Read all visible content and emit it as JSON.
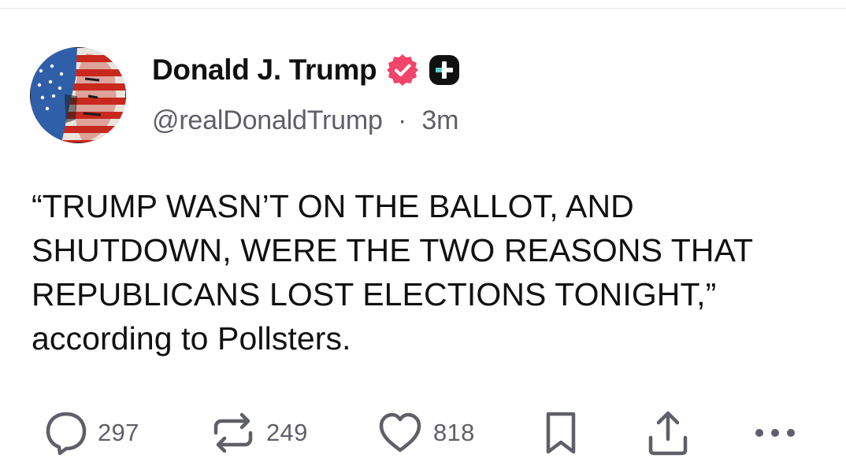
{
  "post": {
    "author": {
      "display_name": "Donald J. Trump",
      "handle": "@realDonaldTrump",
      "separator": "·",
      "time": "3m"
    },
    "text": "“TRUMP WASN’T ON THE BALLOT, AND SHUTDOWN, WERE THE TWO REASONS THAT REPUBLICANS LOST ELECTIONS TONIGHT,” according to Pollsters."
  },
  "actions": {
    "replies": "297",
    "reposts": "249",
    "likes": "818"
  },
  "icons": {
    "verified": "verified-badge-icon",
    "plus": "plus-badge-icon",
    "reply": "reply-icon",
    "repost": "repost-icon",
    "like": "heart-icon",
    "bookmark": "bookmark-icon",
    "share": "share-icon",
    "more": "more-icon"
  },
  "colors": {
    "text": "#111111",
    "muted": "#5f5f68",
    "verified": "#f1456b",
    "plus_badge": "#111111"
  }
}
